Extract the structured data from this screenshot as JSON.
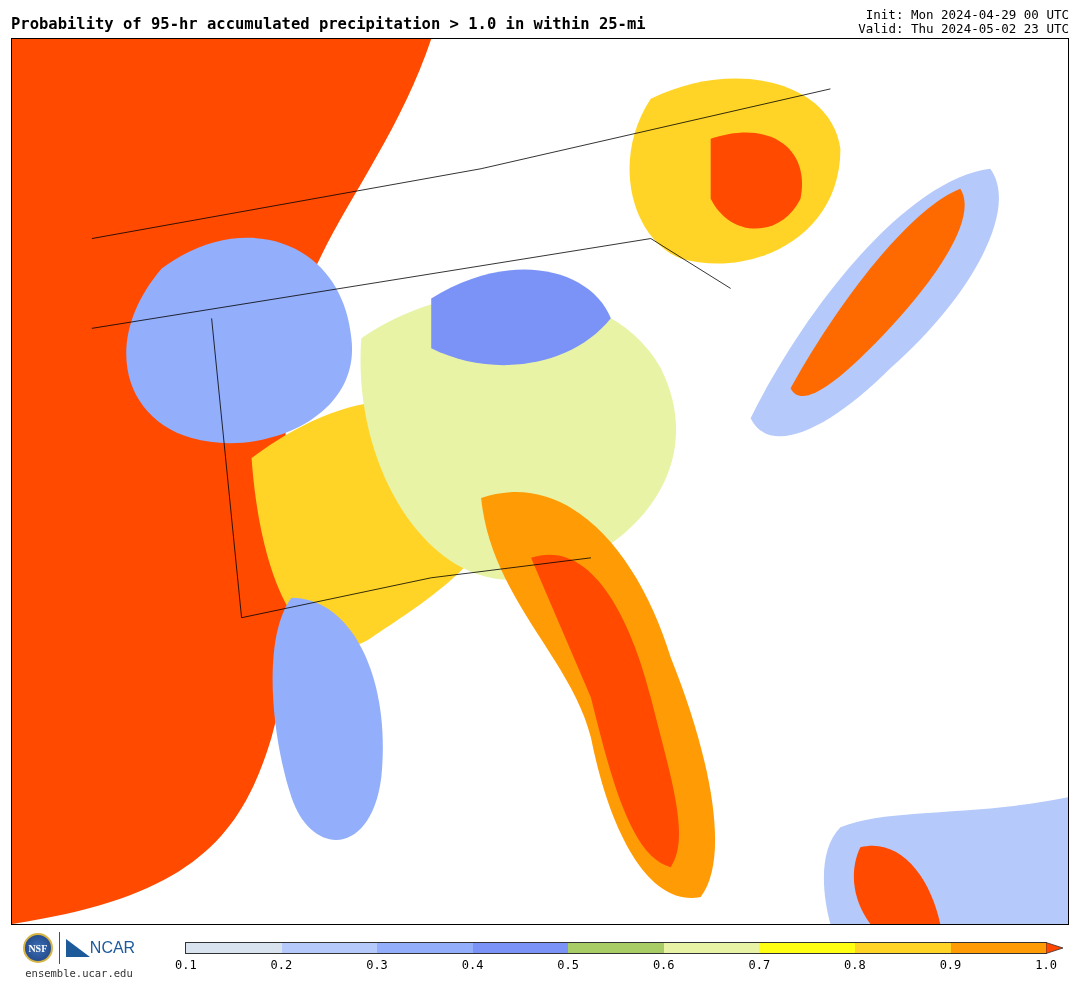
{
  "title": "Probability of 95-hr accumulated precipitation > 1.0 in within 25-mi",
  "init": "Init: Mon 2024-04-29 00 UTC",
  "valid": "Valid: Thu 2024-05-02 23 UTC",
  "logos": {
    "nsf": "NSF",
    "ncar": "NCAR"
  },
  "site": "ensemble.ucar.edu",
  "colorbar": {
    "bins": [
      {
        "color": "#d9e3f0"
      },
      {
        "color": "#b5c9fa"
      },
      {
        "color": "#93aefa"
      },
      {
        "color": "#7b93f7"
      },
      {
        "color": "#a8cc66"
      },
      {
        "color": "#e8f3a6"
      },
      {
        "color": "#ffff14"
      },
      {
        "color": "#ffd426"
      },
      {
        "color": "#ff9c05"
      }
    ],
    "extend": {
      "color": "#ff4500"
    },
    "ticks": [
      "0.1",
      "0.2",
      "0.3",
      "0.4",
      "0.5",
      "0.6",
      "0.7",
      "0.8",
      "0.9",
      "1.0"
    ]
  }
}
